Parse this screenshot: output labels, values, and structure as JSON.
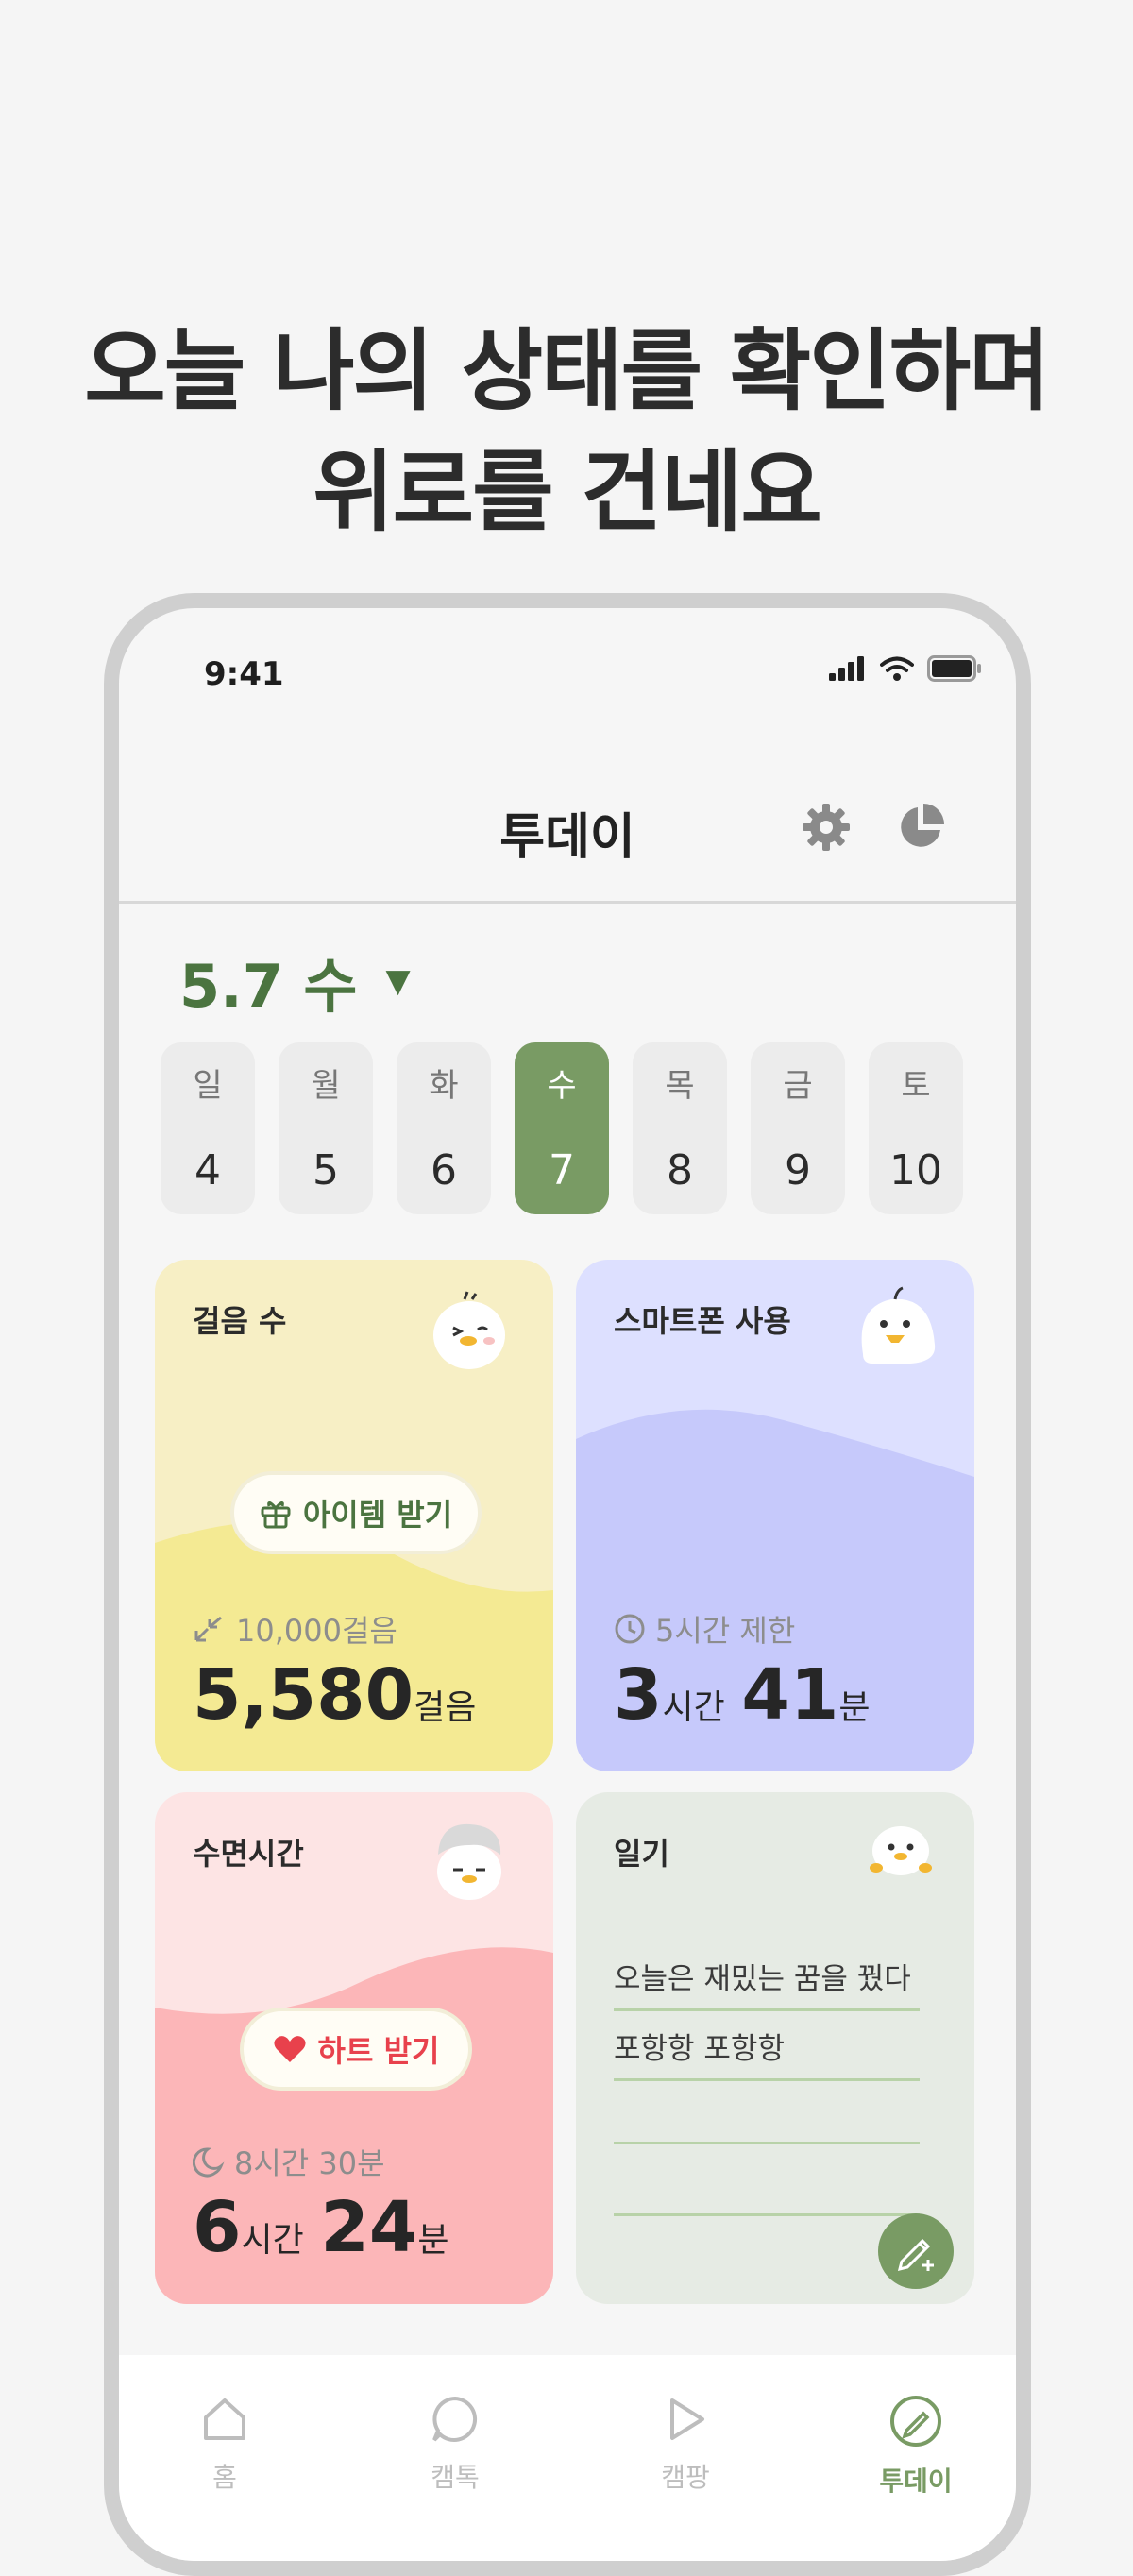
{
  "headline": {
    "line1": "오늘 나의 상태를 확인하며",
    "line2": "위로를 건네요"
  },
  "status_bar": {
    "time": "9:41"
  },
  "app_bar": {
    "title": "투데이"
  },
  "date_header": {
    "label": "5.7 수",
    "caret": "▼"
  },
  "week": [
    {
      "weekday": "일",
      "date": "4"
    },
    {
      "weekday": "월",
      "date": "5"
    },
    {
      "weekday": "화",
      "date": "6"
    },
    {
      "weekday": "수",
      "date": "7",
      "selected": true
    },
    {
      "weekday": "목",
      "date": "8"
    },
    {
      "weekday": "금",
      "date": "9"
    },
    {
      "weekday": "토",
      "date": "10"
    }
  ],
  "cards": {
    "steps": {
      "title": "걸음 수",
      "pill": "아이템 받기",
      "goal": "10,000걸음",
      "value": "5,580",
      "unit": "걸음"
    },
    "phone": {
      "title": "스마트폰 사용",
      "limit": "5시간 제한",
      "hours": "3",
      "hours_unit": "시간",
      "minutes": "41",
      "minutes_unit": "분"
    },
    "sleep": {
      "title": "수면시간",
      "pill": "하트 받기",
      "goal": "8시간 30분",
      "hours": "6",
      "hours_unit": "시간",
      "minutes": "24",
      "minutes_unit": "분"
    },
    "diary": {
      "title": "일기",
      "lines": [
        "오늘은 재밌는 꿈을 꿨다",
        "포항항 포항항",
        "",
        ""
      ]
    }
  },
  "tabs": [
    {
      "label": "홈",
      "icon": "home-icon"
    },
    {
      "label": "캠톡",
      "icon": "chat-icon"
    },
    {
      "label": "캠팡",
      "icon": "play-icon"
    },
    {
      "label": "투데이",
      "icon": "edit-icon",
      "active": true
    }
  ],
  "colors": {
    "accent": "#799b64",
    "steps_bg": "#f7efc5",
    "phone_bg": "#dde0ff",
    "sleep_bg": "#fde4e4",
    "diary_bg": "#e6ebe4",
    "heart": "#e8414c"
  }
}
